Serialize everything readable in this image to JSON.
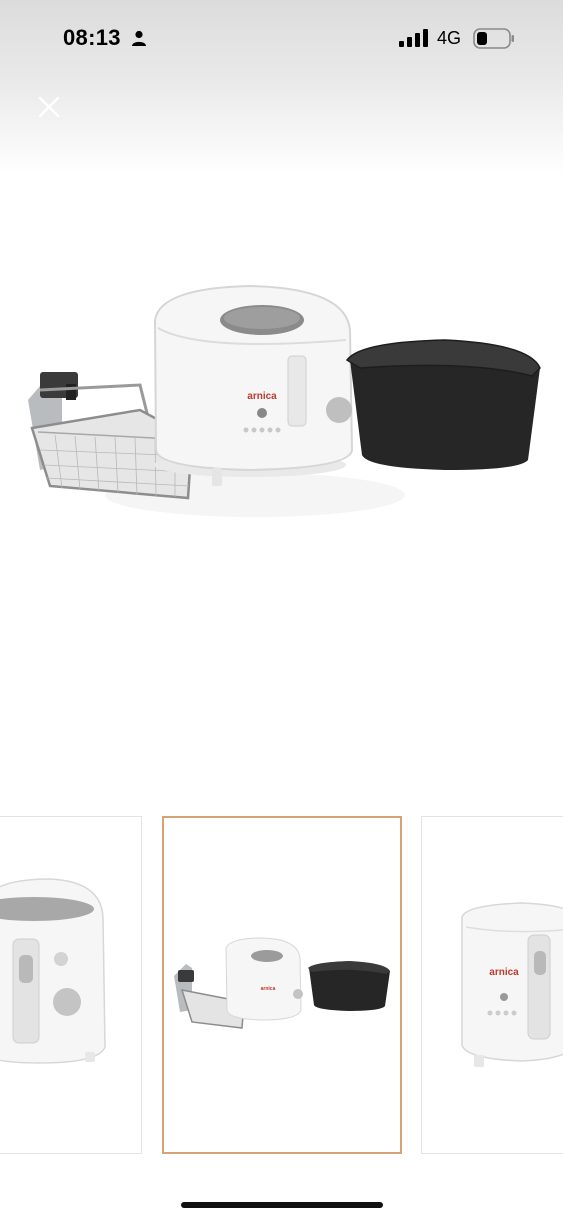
{
  "status_bar": {
    "time": "08:13",
    "network": "4G",
    "icons": [
      "person-icon",
      "signal-icon",
      "battery-icon"
    ]
  },
  "header": {
    "close_icon": "close-icon"
  },
  "main_image": {
    "brand_text": "arnica",
    "brand_color": "#c0392b"
  },
  "thumbnails": {
    "selected_index": 1,
    "selected_border_color": "#d6a474",
    "items": [
      {
        "brand_text": ""
      },
      {
        "brand_text": "arnica"
      },
      {
        "brand_text": "arnica"
      }
    ]
  }
}
